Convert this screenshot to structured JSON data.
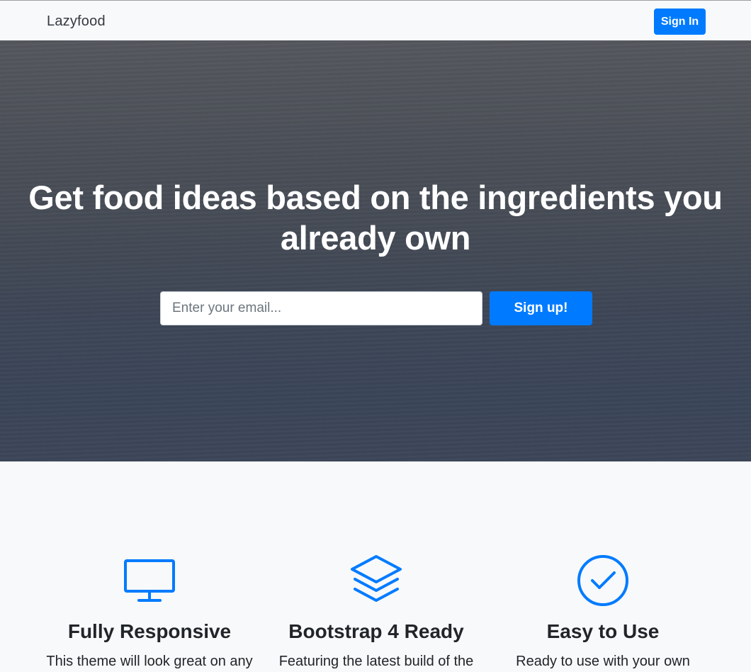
{
  "navbar": {
    "brand": "Lazyfood",
    "signin_label": "Sign In"
  },
  "hero": {
    "title_line1": "Get food ideas based on the ingredients you",
    "title_line2": "already own",
    "email_placeholder": "Enter your email...",
    "signup_label": "Sign up!"
  },
  "features": [
    {
      "icon": "monitor-icon",
      "title": "Fully Responsive",
      "text": "This theme will look great on any"
    },
    {
      "icon": "layers-icon",
      "title": "Bootstrap 4 Ready",
      "text": "Featuring the latest build of the"
    },
    {
      "icon": "check-circle-icon",
      "title": "Easy to Use",
      "text": "Ready to use with your own"
    }
  ],
  "colors": {
    "primary": "#007bff",
    "navbar_bg": "#f8f9fa",
    "hero_text": "#ffffff"
  }
}
